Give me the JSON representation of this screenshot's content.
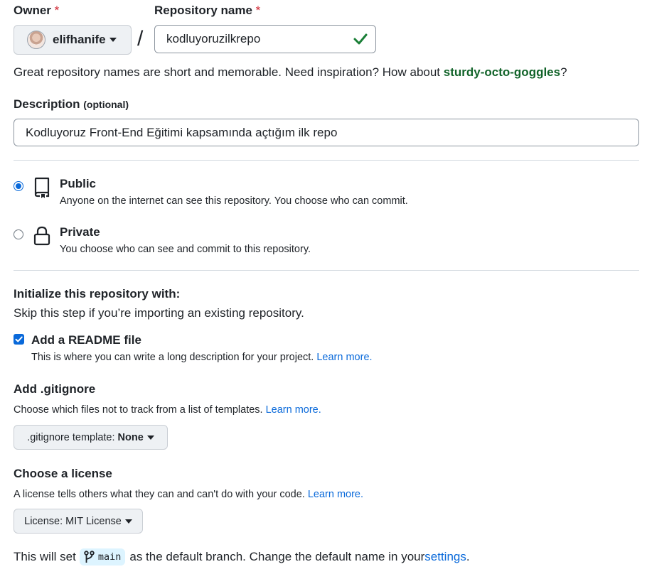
{
  "owner": {
    "label": "Owner",
    "required": "*",
    "value": "elifhanife"
  },
  "repo": {
    "label": "Repository name",
    "required": "*",
    "value": "kodluyoruzilkrepo",
    "separator": "/"
  },
  "hint": {
    "prefix": "Great repository names are short and memorable. Need inspiration? How about ",
    "suggestion": "sturdy-octo-goggles",
    "suffix": "?"
  },
  "description": {
    "label": "Description",
    "optional": "(optional)",
    "value": "Kodluyoruz Front-End Eğitimi kapsamında açtığım ilk repo"
  },
  "visibility": {
    "public": {
      "title": "Public",
      "desc": "Anyone on the internet can see this repository. You choose who can commit."
    },
    "private": {
      "title": "Private",
      "desc": "You choose who can see and commit to this repository."
    }
  },
  "init": {
    "title": "Initialize this repository with:",
    "subtitle": "Skip this step if you’re importing an existing repository."
  },
  "readme": {
    "label": "Add a README file",
    "desc": "This is where you can write a long description for your project. ",
    "learn": "Learn more."
  },
  "gitignore": {
    "title": "Add .gitignore",
    "desc": "Choose which files not to track from a list of templates. ",
    "learn": "Learn more.",
    "button_prefix": ".gitignore template: ",
    "button_value": "None"
  },
  "license": {
    "title": "Choose a license",
    "desc": "A license tells others what they can and can't do with your code. ",
    "learn": "Learn more.",
    "button_prefix": "License: ",
    "button_value": "MIT License"
  },
  "branch": {
    "prefix": "This will set ",
    "name": "main",
    "middle": " as the default branch. Change the default name in your ",
    "link": "settings",
    "suffix": "."
  },
  "colors": {
    "accent": "#0969da",
    "success": "#1a7f37",
    "suggestion": "#116329"
  }
}
